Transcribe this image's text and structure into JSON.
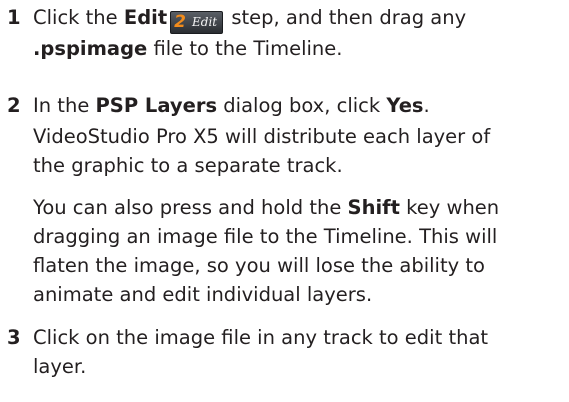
{
  "steps": [
    {
      "number": "1",
      "parts": {
        "a": "Click the ",
        "b_edit": "Edit",
        "badge_num": "2",
        "badge_label": "Edit",
        "c": " step, and then drag any",
        "d_ext": ".pspimage",
        "e": " file to the Timeline."
      }
    },
    {
      "number": "2",
      "parts": {
        "a": "In the ",
        "b_dialog": "PSP Layers",
        "c": " dialog box, click ",
        "d_yes": "Yes",
        "e": "."
      },
      "note1": {
        "line1": "VideoStudio Pro X5 will distribute each layer of",
        "line2": "the graphic to a separate track."
      },
      "note2": {
        "a": "You can also press and hold the ",
        "b_shift": "Shift",
        "c": " key when",
        "line2": "dragging an image file to the Timeline. This will",
        "line3": "flaten the image, so you will lose the ability to",
        "line4": "animate and edit individual layers."
      }
    },
    {
      "number": "3",
      "parts": {
        "line1": "Click on the image file in any track to edit that",
        "line2": "layer."
      }
    }
  ]
}
